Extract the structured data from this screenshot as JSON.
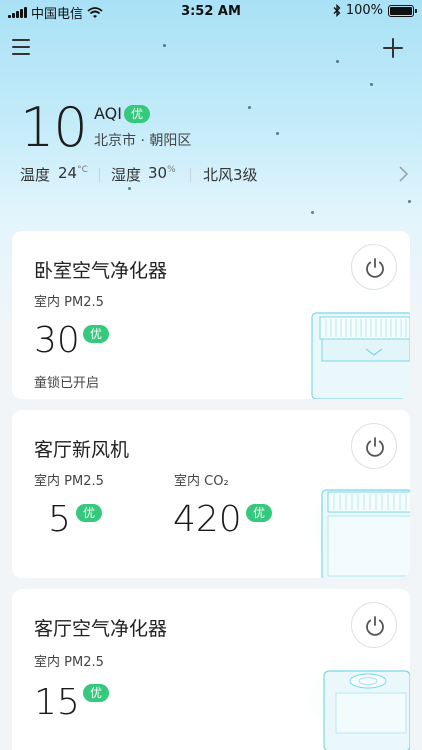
{
  "status_bar": {
    "carrier": "中国电信",
    "time": "3:52 AM",
    "battery": "100%",
    "battery_level": 1.0
  },
  "header": {
    "menu_icon": "hamburger-menu-icon",
    "add_icon": "plus-icon"
  },
  "air_quality": {
    "value": "10",
    "label": "AQI",
    "rating": "优",
    "location": "北京市 · 朝阳区"
  },
  "weather": {
    "temp_label": "温度",
    "temp_value": "24",
    "temp_unit": "°C",
    "humidity_label": "湿度",
    "humidity_value": "30",
    "humidity_unit": "%",
    "wind": "北风3级"
  },
  "devices": [
    {
      "name": "卧室空气净化器",
      "metric_label": "室内 PM2.5",
      "metric_value": "30",
      "metric_rating": "优",
      "note": "童锁已开启"
    },
    {
      "name": "客厅新风机",
      "metric_label": "室内 PM2.5",
      "metric_value": "5",
      "metric_rating": "优",
      "metric2_label": "室内 CO₂",
      "metric2_value": "420",
      "metric2_rating": "优"
    },
    {
      "name": "客厅空气净化器",
      "metric_label": "室内 PM2.5",
      "metric_value": "15",
      "metric_rating": "优"
    }
  ],
  "colors": {
    "accent_green": "#34c97d",
    "sky_top": "#a9e1f6",
    "page_bg": "#f1f5f8",
    "device_line": "#7fd6e6"
  }
}
